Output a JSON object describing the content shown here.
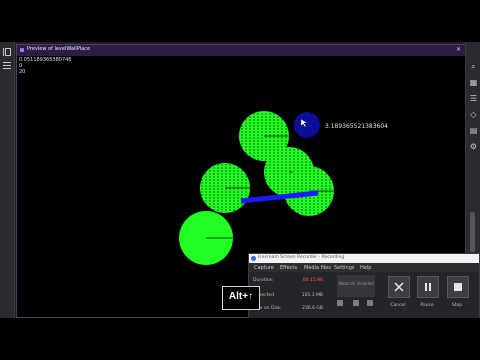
{
  "preview": {
    "title": "Preview of levelWallPlace",
    "debug_lines": [
      "0.051189365380746",
      "0",
      "20"
    ],
    "point_label": "3.189365521383604"
  },
  "recorder": {
    "title": "Icecream Screen Recorder - Recording",
    "menu": [
      "Capture",
      "Effects",
      "Media files",
      "Settings",
      "Help"
    ],
    "rows": [
      {
        "label": "Duration",
        "value": "00:15:96",
        "highlight": true
      },
      {
        "label": "Expected",
        "value": "105.3 MB",
        "highlight": false
      },
      {
        "label": "Free on Disk",
        "value": "236.6 GB",
        "highlight": false
      }
    ],
    "box_text": "Webcam disabled",
    "buttons": {
      "cancel": "Cancel",
      "pause": "Pause",
      "stop": "Stop"
    }
  },
  "keystroke": "Alt+↑",
  "colors": {
    "circle_green": "#22ff22",
    "blue_bar": "#1a1aff",
    "dark_blue_circle": "#0d0d9a",
    "duration_red": "#ff5a4d"
  }
}
